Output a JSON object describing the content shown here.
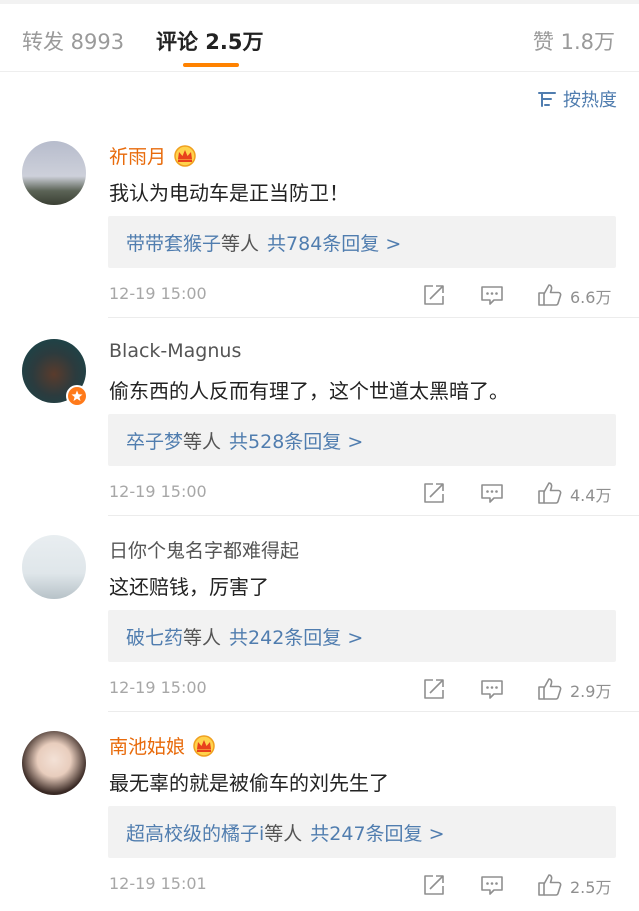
{
  "tabs": {
    "repost": "转发 8993",
    "comments": "评论 2.5万",
    "likes": "赞 1.8万"
  },
  "sort": {
    "label": "按热度"
  },
  "colors": {
    "accent": "#ff8200",
    "link": "#507daf",
    "vip_name": "#e86b0c"
  },
  "comments": [
    {
      "name": "祈雨月",
      "vip": true,
      "text": "我认为电动车是正当防卫！",
      "reply_users": "带带套猴子",
      "reply_suffix": "等人",
      "reply_count": "共784条回复 >",
      "time": "12-19 15:00",
      "likes": "6.6万"
    },
    {
      "name": "Black-Magnus",
      "vip": false,
      "verified": true,
      "text": "偷东西的人反而有理了，这个世道太黑暗了。",
      "reply_users": "卒子梦",
      "reply_suffix": "等人",
      "reply_count": "共528条回复 >",
      "time": "12-19 15:00",
      "likes": "4.4万"
    },
    {
      "name": "日你个鬼名字都难得起",
      "vip": false,
      "text": "这还赔钱，厉害了",
      "reply_users": "破七药",
      "reply_suffix": "等人",
      "reply_count": "共242条回复 >",
      "time": "12-19 15:00",
      "likes": "2.9万"
    },
    {
      "name": "南池姑娘",
      "vip": true,
      "text": "最无辜的就是被偷车的刘先生了",
      "reply_users": "超高校级的橘子i",
      "reply_suffix": "等人",
      "reply_count": "共247条回复 >",
      "time": "12-19 15:01",
      "likes": "2.5万"
    }
  ],
  "icons": {
    "sort": "sort-lines-icon",
    "crown": "vip-crown-icon",
    "verified": "verified-badge-icon",
    "share": "share-icon",
    "comment": "comment-icon",
    "like": "thumbs-up-icon"
  }
}
